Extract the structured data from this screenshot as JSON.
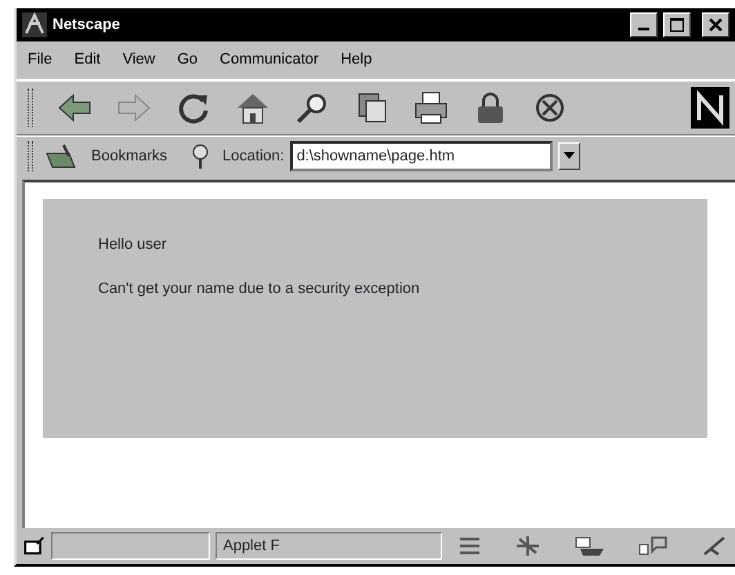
{
  "window": {
    "title": "Netscape"
  },
  "menu": [
    "File",
    "Edit",
    "View",
    "Go",
    "Communicator",
    "Help"
  ],
  "location_bar": {
    "bookmarks": "Bookmarks",
    "location_label": "Location:",
    "url": "d:\\showname\\page.htm"
  },
  "content": {
    "greeting": "Hello user",
    "message": "Can't get your name due to a security exception"
  },
  "status_bar": {
    "text": "Applet F"
  }
}
